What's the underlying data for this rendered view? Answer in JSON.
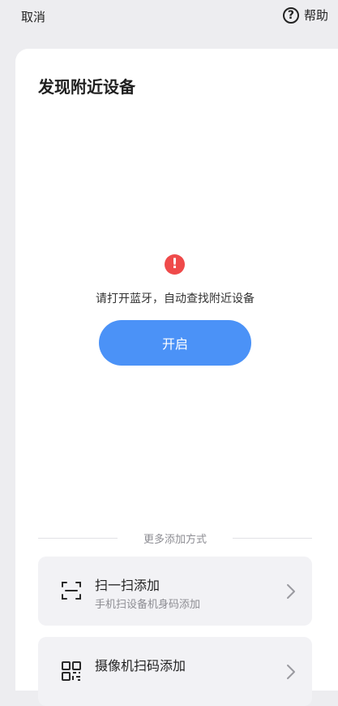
{
  "topbar": {
    "cancel_label": "取消",
    "help_label": "帮助",
    "help_icon": "question-circle-icon"
  },
  "card": {
    "title": "发现附近设备",
    "warning_icon": "exclamation-circle-icon",
    "warning_text": "请打开蓝牙，自动查找附近设备",
    "enable_button_label": "开启"
  },
  "more_methods": {
    "divider_label": "更多添加方式",
    "options": [
      {
        "title": "扫一扫添加",
        "subtitle": "手机扫设备机身码添加",
        "icon": "scan-frame-icon"
      },
      {
        "title": "摄像机扫码添加",
        "subtitle": "",
        "icon": "qr-code-icon"
      }
    ]
  },
  "colors": {
    "background": "#ededf0",
    "card": "#ffffff",
    "accent": "#4b92f7",
    "warning": "#ef4a4a",
    "option_bg": "#f2f2f5",
    "muted_text": "#8d8d93"
  }
}
